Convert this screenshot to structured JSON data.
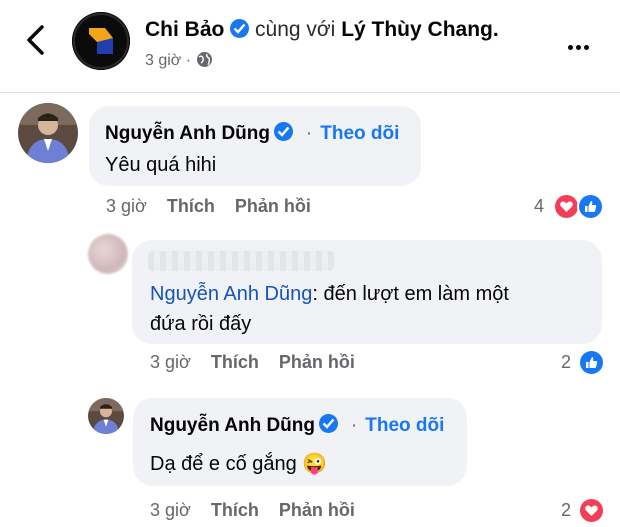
{
  "post_header": {
    "author": "Chi Bảo",
    "with_text": "cùng với",
    "tagged": "Lý Thùy Chang.",
    "time": "3 giờ",
    "separator": "·",
    "privacy_icon": "globe-icon"
  },
  "comments": [
    {
      "author": "Nguyễn Anh Dũng",
      "verified": true,
      "follow_label": "Theo dõi",
      "text": "Yêu quá hihi",
      "time": "3 giờ",
      "like_label": "Thích",
      "reply_label": "Phản hồi",
      "reaction_count": "4",
      "reactions": [
        "love",
        "like"
      ]
    },
    {
      "mention": "Nguyễn Anh Dũng",
      "text_line1": ": đến lượt em làm một",
      "text_line2": "đứa rồi đấy",
      "time": "3 giờ",
      "like_label": "Thích",
      "reply_label": "Phản hồi",
      "reaction_count": "2",
      "reactions": [
        "like"
      ]
    },
    {
      "author": "Nguyễn Anh Dũng",
      "verified": true,
      "follow_label": "Theo dõi",
      "text": "Dạ để e cố gắng",
      "emoji": "😜",
      "time": "3 giờ",
      "like_label": "Thích",
      "reply_label": "Phản hồi",
      "reaction_count": "2",
      "reactions": [
        "love"
      ]
    }
  ],
  "colors": {
    "accent": "#1877f2",
    "love": "#f33e58",
    "bubble": "#f0f2f5",
    "muted": "#65676b"
  }
}
